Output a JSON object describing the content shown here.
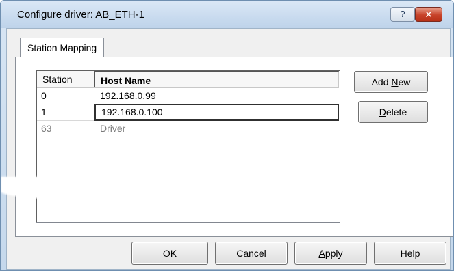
{
  "window": {
    "title": "Configure driver: AB_ETH-1",
    "help_glyph": "?",
    "close_glyph": "✕"
  },
  "tabs": [
    {
      "label": "Station Mapping"
    }
  ],
  "grid": {
    "columns": [
      "Station",
      "Host Name"
    ],
    "rows": [
      {
        "station": "0",
        "host": "192.168.0.99"
      },
      {
        "station": "1",
        "host": "192.168.0.100"
      },
      {
        "station": "63",
        "host": "Driver"
      }
    ]
  },
  "side_buttons": {
    "add_new_pre": "Add ",
    "add_new_accel": "N",
    "add_new_post": "ew",
    "delete_accel": "D",
    "delete_post": "elete"
  },
  "bottom_buttons": {
    "ok": "OK",
    "cancel": "Cancel",
    "apply_accel": "A",
    "apply_post": "pply",
    "help": "Help"
  },
  "icons": {
    "help": "question-mark-icon",
    "close": "close-icon"
  },
  "colors": {
    "close_button": "#c7432a",
    "titlebar": "#c9dbef"
  }
}
